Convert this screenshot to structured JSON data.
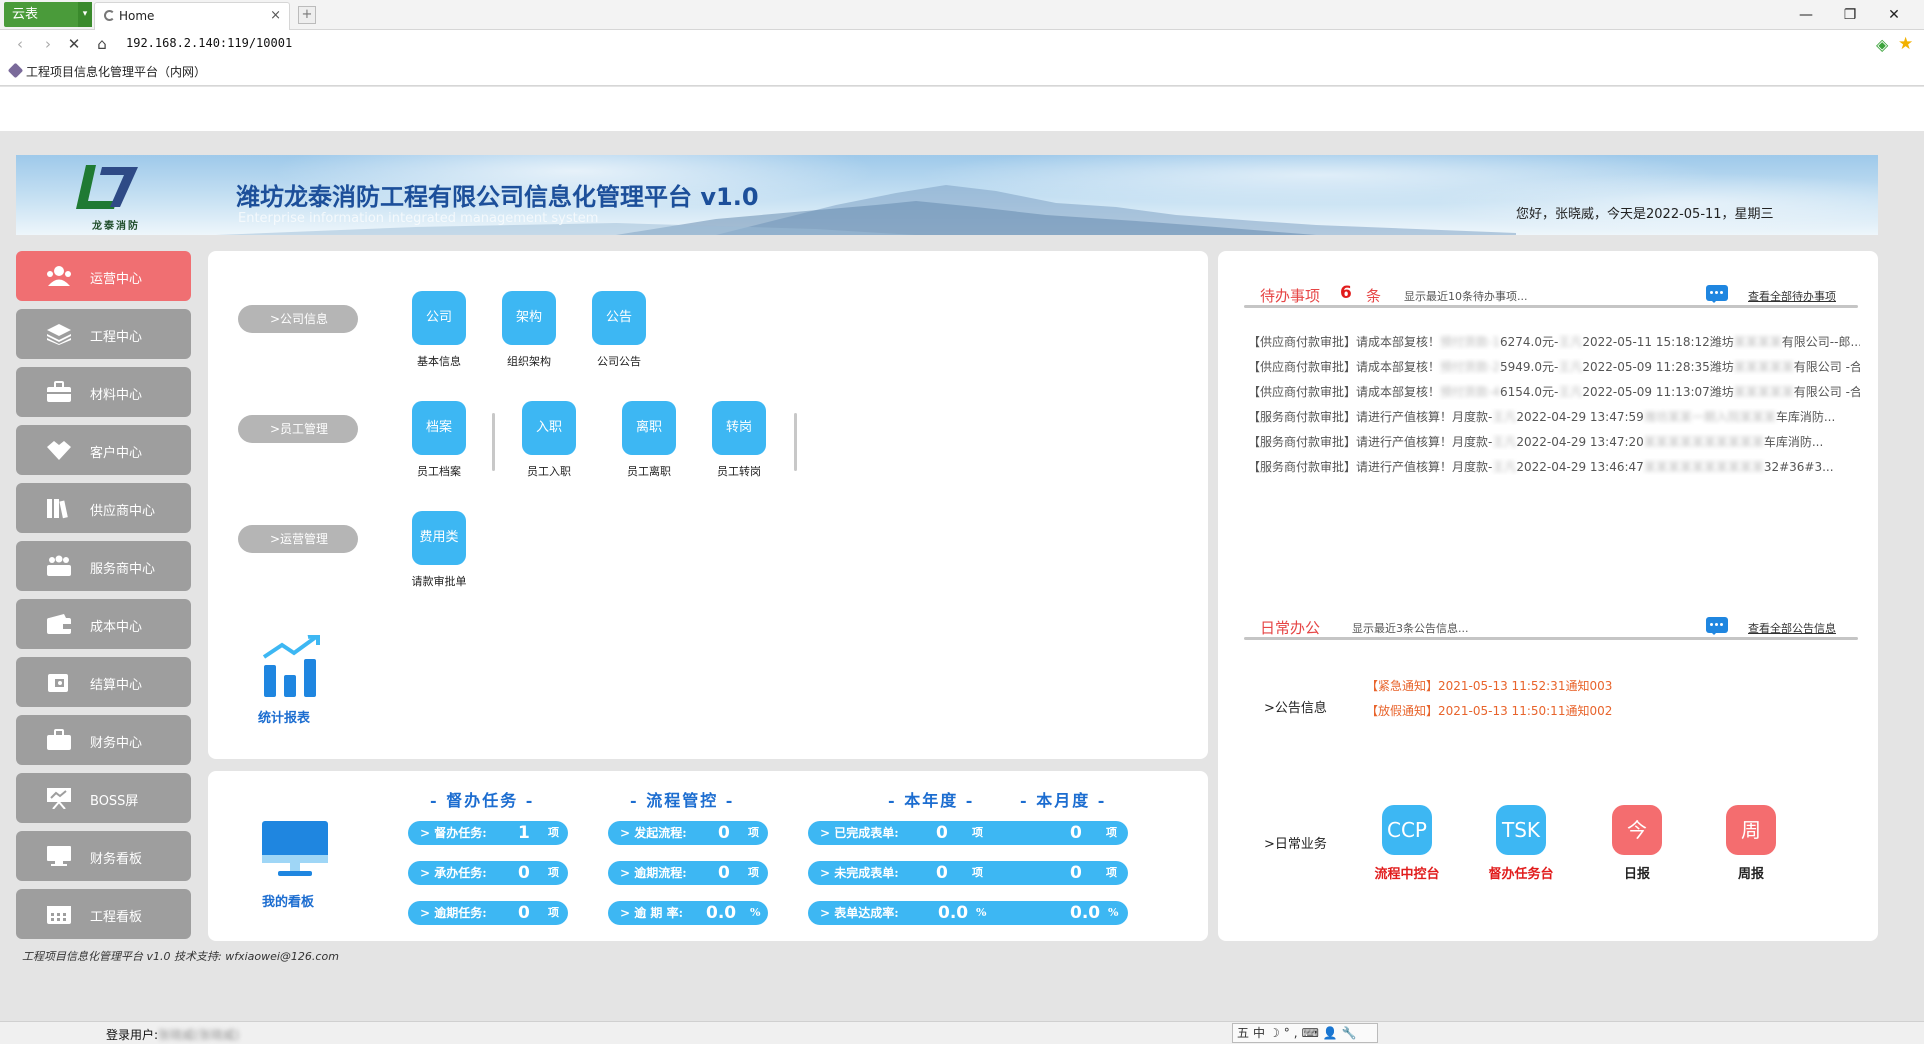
{
  "browser": {
    "brand": "云表",
    "tab_title": "Home",
    "url": "192.168.2.140:119/10001",
    "bookmark": "工程项目信息化管理平台（内网）"
  },
  "banner": {
    "title": "潍坊龙泰消防工程有限公司信息化管理平台 v1.0",
    "subtitle": "Enterprise information integrated management system",
    "logo_text": "龙泰消防",
    "greeting": "您好，张晓威，今天是2022-05-11，星期三"
  },
  "sidebar": [
    {
      "label": "运营中心",
      "icon": "people-icon"
    },
    {
      "label": "工程中心",
      "icon": "layers-icon"
    },
    {
      "label": "材料中心",
      "icon": "toolbox-icon"
    },
    {
      "label": "客户中心",
      "icon": "handshake-icon"
    },
    {
      "label": "供应商中心",
      "icon": "books-icon"
    },
    {
      "label": "服务商中心",
      "icon": "team-icon"
    },
    {
      "label": "成本中心",
      "icon": "wallet-icon"
    },
    {
      "label": "结算中心",
      "icon": "purse-icon"
    },
    {
      "label": "财务中心",
      "icon": "briefcase-icon"
    },
    {
      "label": "BOSS屏",
      "icon": "presentation-icon"
    },
    {
      "label": "财务看板",
      "icon": "monitor-icon"
    },
    {
      "label": "工程看板",
      "icon": "calendar-icon"
    }
  ],
  "center": {
    "groups": [
      {
        "label": ">公司信息",
        "tiles": [
          {
            "tile": "公司",
            "label": "基本信息"
          },
          {
            "tile": "架构",
            "label": "组织架构"
          },
          {
            "tile": "公告",
            "label": "公司公告"
          }
        ]
      },
      {
        "label": ">员工管理",
        "tiles": [
          {
            "tile": "档案",
            "label": "员工档案"
          },
          {
            "tile": "入职",
            "label": "员工入职"
          },
          {
            "tile": "离职",
            "label": "员工离职"
          },
          {
            "tile": "转岗",
            "label": "员工转岗"
          }
        ]
      },
      {
        "label": ">运营管理",
        "tiles": [
          {
            "tile": "费用类",
            "label": "请款审批单"
          }
        ]
      }
    ],
    "stats_label": "统计报表"
  },
  "dashboard": {
    "my_board": "我的看板",
    "headers": {
      "todo": "- 督办任务 -",
      "flow": "- 流程管控 -",
      "year": "- 本年度 -",
      "month": "- 本月度 -"
    },
    "todo": [
      {
        "key": "> 督办任务:",
        "value": "1",
        "unit": "项"
      },
      {
        "key": "> 承办任务:",
        "value": "0",
        "unit": "项"
      },
      {
        "key": "> 逾期任务:",
        "value": "0",
        "unit": "项"
      }
    ],
    "flow": [
      {
        "key": "> 发起流程:",
        "value": "0",
        "unit": "项"
      },
      {
        "key": "> 逾期流程:",
        "value": "0",
        "unit": "项"
      },
      {
        "key": "> 逾 期 率:",
        "value": "0.0",
        "unit": "%"
      }
    ],
    "period": [
      {
        "key": "> 已完成表单:",
        "year": "0",
        "year_unit": "项",
        "month": "0",
        "month_unit": "项"
      },
      {
        "key": "> 未完成表单:",
        "year": "0",
        "year_unit": "项",
        "month": "0",
        "month_unit": "项"
      },
      {
        "key": "> 表单达成率:",
        "year": "0.0",
        "year_unit": "%",
        "month": "0.0",
        "month_unit": "%"
      }
    ]
  },
  "todo_panel": {
    "title": "待办事项",
    "count": "6",
    "count_unit": "条",
    "hint": "显示最近10条待办事项...",
    "link": "查看全部待办事项",
    "items": [
      {
        "head": "【供应商付款审批】请成本部复核！",
        "blur1": "预付货款-1",
        "mid": "6274.0元-",
        "blur2": "王凡",
        "tail": "2022-05-11 15:18:12潍坊",
        "blur3": "某某某某",
        "end": "有限公司--郎..."
      },
      {
        "head": "【供应商付款审批】请成本部复核！",
        "blur1": "预付货款-2",
        "mid": "5949.0元-",
        "blur2": "王凡",
        "tail": "2022-05-09 11:28:35潍坊",
        "blur3": "某某某某某",
        "end": "有限公司 -合..."
      },
      {
        "head": "【供应商付款审批】请成本部复核！",
        "blur1": "预付货款-4",
        "mid": "6154.0元-",
        "blur2": "王凡",
        "tail": "2022-05-09 11:13:07潍坊",
        "blur3": "某某某某某",
        "end": "有限公司 -合..."
      },
      {
        "head": "【服务商付款审批】请进行产值核算！月度款-",
        "blur1": "",
        "mid": "",
        "blur2": "王凡",
        "tail": "2022-04-29 13:47:59",
        "blur3": "潍坊某某一期入院某某某",
        "end": "车库消防..."
      },
      {
        "head": "【服务商付款审批】请进行产值核算！月度款-",
        "blur1": "",
        "mid": "",
        "blur2": "王凡",
        "tail": "2022-04-29 13:47:20",
        "blur3": "某某某某某某某某某某",
        "end": "车库消防..."
      },
      {
        "head": "【服务商付款审批】请进行产值核算！月度款-",
        "blur1": "",
        "mid": "",
        "blur2": "王凡",
        "tail": "2022-04-29 13:46:47",
        "blur3": "某某某某某某某某某某",
        "end": "32#36#3..."
      }
    ]
  },
  "office_panel": {
    "title": "日常办公",
    "hint": "显示最近3条公告信息...",
    "link": "查看全部公告信息",
    "notice_label": ">公告信息",
    "notices": [
      "【紧急通知】2021-05-13 11:52:31通知003",
      "【放假通知】2021-05-13 11:50:11通知002"
    ],
    "biz_label": ">日常业务",
    "biz": [
      {
        "tile": "CCP",
        "label": "流程中控台",
        "color": "#3db7f3",
        "label_color": "#e11c1c"
      },
      {
        "tile": "TSK",
        "label": "督办任务台",
        "color": "#3db7f3",
        "label_color": "#e11c1c"
      },
      {
        "tile": "今",
        "label": "日报",
        "color": "#f46d6f",
        "label_color": "#222222"
      },
      {
        "tile": "周",
        "label": "周报",
        "color": "#f46d6f",
        "label_color": "#222222"
      }
    ]
  },
  "footer": {
    "text": "工程项目信息化管理平台 v1.0    技术支持: wfxiaowei@126.com",
    "login_label": "登录用户:",
    "login_user": "张晓威(张晓威)",
    "ime": "五中☽°,⌨👤🔧"
  },
  "colors": {
    "accent": "#3db7f3",
    "active_menu": "#f06f72",
    "menu": "#9e9e9e",
    "title_blue": "#1c4f9a",
    "red": "#e64646"
  }
}
